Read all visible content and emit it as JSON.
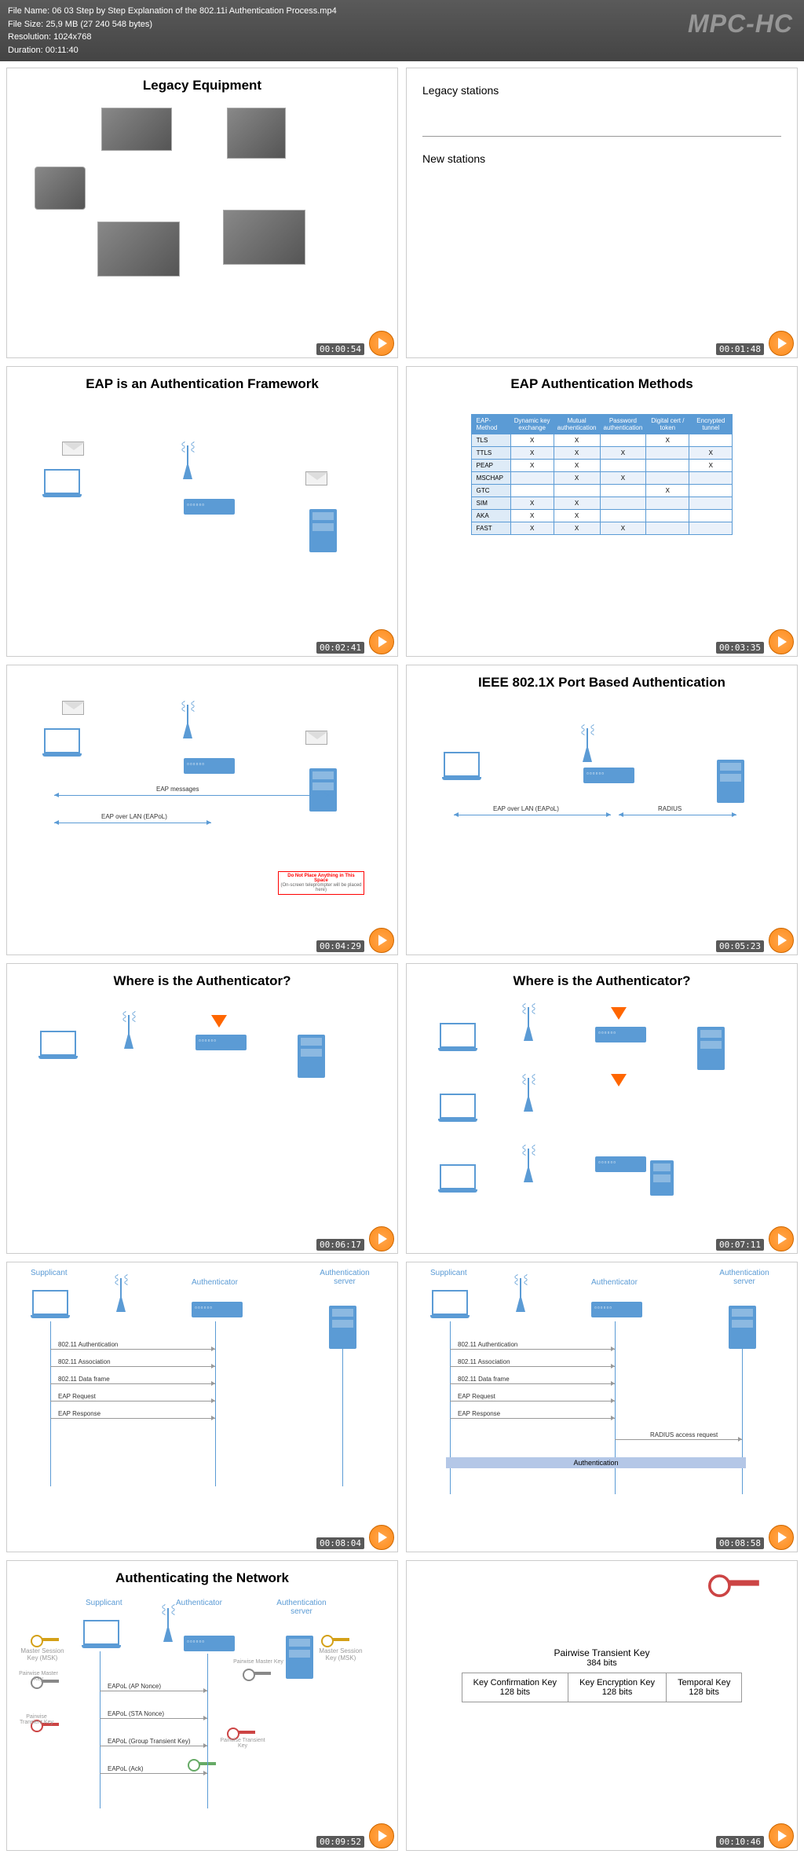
{
  "header": {
    "file_name_label": "File Name:",
    "file_name": "06 03 Step by Step Explanation of the 802.11i Authentication Process.mp4",
    "file_size_label": "File Size:",
    "file_size": "25,9 MB (27 240 548 bytes)",
    "resolution_label": "Resolution:",
    "resolution": "1024x768",
    "duration_label": "Duration:",
    "duration": "00:11:40",
    "watermark": "MPC-HC"
  },
  "slides": [
    {
      "title": "Legacy Equipment",
      "ts": "00:00:54"
    },
    {
      "legacy": "Legacy stations",
      "new": "New stations",
      "ts": "00:01:48"
    },
    {
      "title": "EAP is an Authentication Framework",
      "ts": "00:02:41"
    },
    {
      "title": "EAP Authentication Methods",
      "ts": "00:03:35",
      "cols": [
        "EAP-Method",
        "Dynamic key exchange",
        "Mutual authentication",
        "Password authentication",
        "Digital cert / token",
        "Encrypted tunnel"
      ],
      "rows": [
        [
          "TLS",
          "X",
          "X",
          "",
          "X",
          ""
        ],
        [
          "TTLS",
          "X",
          "X",
          "X",
          "",
          "X"
        ],
        [
          "PEAP",
          "X",
          "X",
          "",
          "",
          "X"
        ],
        [
          "MSCHAP",
          "",
          "X",
          "X",
          "",
          ""
        ],
        [
          "GTC",
          "",
          "",
          "",
          "X",
          ""
        ],
        [
          "SIM",
          "X",
          "X",
          "",
          "",
          ""
        ],
        [
          "AKA",
          "X",
          "X",
          "",
          "",
          ""
        ],
        [
          "FAST",
          "X",
          "X",
          "X",
          "",
          ""
        ]
      ]
    },
    {
      "title": "",
      "ts": "00:04:29",
      "msgs": [
        "EAP messages",
        "EAP over LAN (EAPoL)"
      ],
      "warn_title": "Do Not Place Anything in This Space"
    },
    {
      "title": "IEEE 802.1X Port Based Authentication",
      "ts": "00:05:23",
      "msgs": [
        "EAP over LAN (EAPoL)",
        "RADIUS"
      ]
    },
    {
      "title": "Where is the Authenticator?",
      "ts": "00:06:17"
    },
    {
      "title": "Where is the Authenticator?",
      "ts": "00:07:11"
    },
    {
      "ts": "00:08:04",
      "roles": [
        "Supplicant",
        "Authenticator",
        "Authentication server"
      ],
      "steps": [
        "802.11 Authentication",
        "802.11 Association",
        "802.11 Data frame",
        "EAP Request",
        "EAP Response"
      ]
    },
    {
      "ts": "00:08:58",
      "roles": [
        "Supplicant",
        "Authenticator",
        "Authentication server"
      ],
      "steps": [
        "802.11 Authentication",
        "802.11 Association",
        "802.11 Data frame",
        "EAP Request",
        "EAP Response"
      ],
      "extra": "RADIUS access request",
      "authbar": "Authentication"
    },
    {
      "title": "Authenticating the Network",
      "ts": "00:09:52",
      "roles": [
        "Supplicant",
        "Authenticator",
        "Authentication server"
      ],
      "keys": [
        "Master Session Key (MSK)",
        "Pairwise Master Key",
        "Pairwise Transient Key",
        "Master Session Key (MSK)",
        "Pairwise Master Key",
        "Pairwise Transient Key"
      ],
      "eapol": [
        "EAPoL (AP Nonce)",
        "EAPoL (STA Nonce)",
        "EAPoL (Group Transient Key)",
        "EAPoL (Ack)"
      ]
    },
    {
      "ts": "00:10:46",
      "ptk_title": "Pairwise Transient Key",
      "ptk_bits": "384 bits",
      "cells": [
        [
          "Key Confirmation Key",
          "128 bits"
        ],
        [
          "Key Encryption Key",
          "128 bits"
        ],
        [
          "Temporal Key",
          "128 bits"
        ]
      ]
    }
  ]
}
